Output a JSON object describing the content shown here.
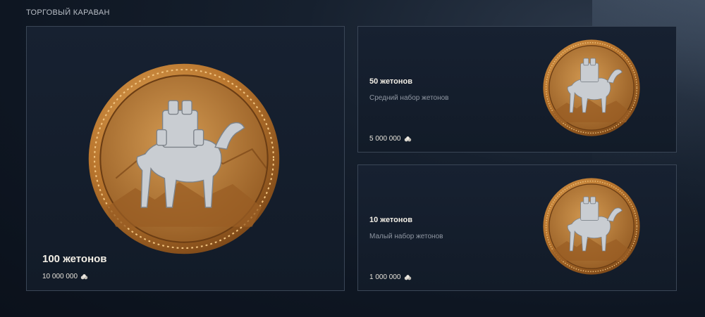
{
  "section": {
    "title": "ТОРГОВЫЙ КАРАВАН"
  },
  "offers": [
    {
      "title": "100 жетонов",
      "price": "10 000 000"
    },
    {
      "title": "50 жетонов",
      "subtitle": "Средний набор жетонов",
      "price": "5 000 000"
    },
    {
      "title": "10 жетонов",
      "subtitle": "Малый набор жетонов",
      "price": "1 000 000"
    }
  ],
  "icons": {
    "coin": "camel-coin-icon",
    "currency": "credits-icon"
  },
  "colors": {
    "coin_gold": "#c98a3a",
    "card_border": "#3a4656",
    "background": "#0e1622"
  }
}
